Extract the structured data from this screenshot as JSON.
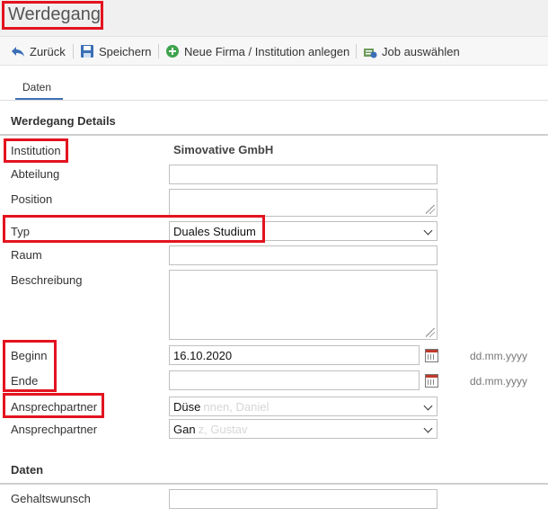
{
  "page": {
    "title": "Werdegang"
  },
  "toolbar": {
    "back": "Zurück",
    "save": "Speichern",
    "new_company": "Neue Firma / Institution anlegen",
    "select_job": "Job auswählen"
  },
  "tabs": [
    {
      "label": "Daten"
    }
  ],
  "sections": {
    "details": "Werdegang Details",
    "daten": "Daten"
  },
  "fields": {
    "institution": {
      "label": "Institution",
      "value": "Simovative GmbH"
    },
    "abteilung": {
      "label": "Abteilung",
      "value": ""
    },
    "position": {
      "label": "Position",
      "value": ""
    },
    "typ": {
      "label": "Typ",
      "value": "Duales Studium"
    },
    "raum": {
      "label": "Raum",
      "value": ""
    },
    "beschreibung": {
      "label": "Beschreibung",
      "value": ""
    },
    "beginn": {
      "label": "Beginn",
      "value": "16.10.2020",
      "format_hint": "dd.mm.yyyy"
    },
    "ende": {
      "label": "Ende",
      "value": "",
      "format_hint": "dd.mm.yyyy"
    },
    "ansprechpartner1": {
      "label": "Ansprechpartner",
      "value": "Düse",
      "value_rest": "nnen, Daniel"
    },
    "ansprechpartner2": {
      "label": "Ansprechpartner",
      "value": "Gan",
      "value_rest": "z, Gustav"
    },
    "gehaltswunsch": {
      "label": "Gehaltswunsch",
      "value": ""
    }
  },
  "colors": {
    "highlight": "#e3131f",
    "tab_accent": "#3f72b5"
  }
}
